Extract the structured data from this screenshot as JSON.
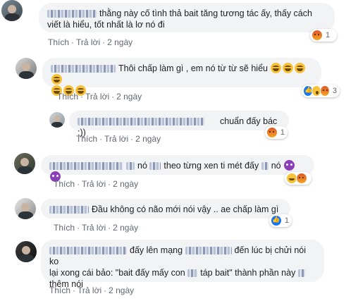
{
  "actions": {
    "like": "Thích",
    "reply": "Trả lời",
    "sep": "·"
  },
  "comments": [
    {
      "text": "thằng này cố tình thả bait tăng tương tác ấy, thấy cách viết là hiểu, tốt nhất là lơ nó đi",
      "line1": "thằng này cố tình thả bait tăng tương tác ấy, thấy cách",
      "line2": "viết là hiểu, tốt nhất là lơ nó đi",
      "time": "2 ngày",
      "reaction_count": "1",
      "reactions": [
        "angry-icon"
      ]
    },
    {
      "text": "Thôi chấp làm gì , em nó từ từ sẽ hiểu",
      "time": "2 ngày",
      "reaction_count": "3",
      "reactions": [
        "like-icon",
        "wow-icon",
        "angry-icon"
      ]
    },
    {
      "text": "chuẩn đấy bác :))",
      "time": "2 ngày",
      "reaction_count": "1",
      "reactions": [
        "angry-icon"
      ]
    },
    {
      "text_a": "nó",
      "text_b": "theo từng xen ti mét đấy",
      "text_c": "nó",
      "time": "2 ngày",
      "reactions": [
        "haha-icon",
        "angry-icon"
      ]
    },
    {
      "text": "Đầu không có não mới nói vậy .. ae chấp làm gì",
      "time": "2 ngày",
      "reaction_count": "1",
      "reactions": [
        "like-icon"
      ]
    },
    {
      "text_a": "đấy lên mạng",
      "text_b": "đến lúc bị chửi nói ko",
      "line2_a": "lại xong cái bảo: \"bait đấy mấy con",
      "line2_b": "táp bait\" thành phần này",
      "line3": "thêm nói",
      "time": "2 ngày"
    }
  ],
  "colors": {
    "bubble": "#f2f3f5",
    "meta": "#606770",
    "text": "#1c1e21"
  }
}
